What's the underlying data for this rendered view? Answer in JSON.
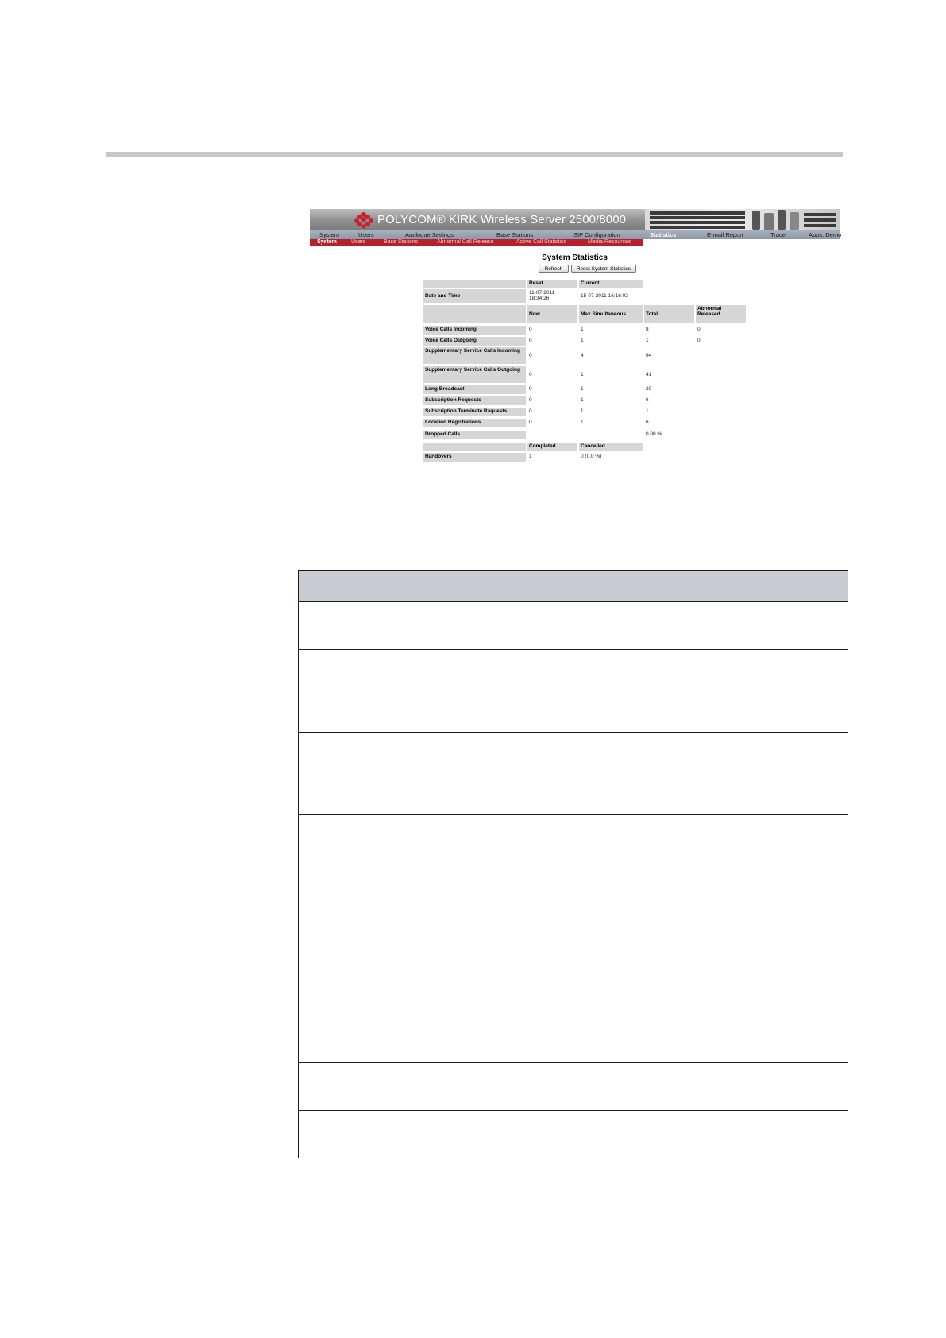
{
  "app": {
    "brand_title": "POLYCOM® KIRK Wireless Server 2500/8000"
  },
  "nav_main": [
    {
      "label": "System",
      "active": false
    },
    {
      "label": "Users",
      "active": false
    },
    {
      "label": "Analogue Settings",
      "active": false
    },
    {
      "label": "Base Stations",
      "active": false
    },
    {
      "label": "SIP Configuration",
      "active": false
    },
    {
      "label": "Statistics",
      "active": true
    },
    {
      "label": "E-mail Report",
      "active": false
    },
    {
      "label": "Trace",
      "active": false
    },
    {
      "label": "Apps. Demo",
      "active": false
    }
  ],
  "nav_sub": [
    {
      "label": "System",
      "active": true
    },
    {
      "label": "Users",
      "active": false
    },
    {
      "label": "Base Stations",
      "active": false
    },
    {
      "label": "Abnormal Call Release",
      "active": false
    },
    {
      "label": "Active Call Statistics",
      "active": false
    },
    {
      "label": "Media Resources",
      "active": false
    }
  ],
  "stats": {
    "title": "System Statistics",
    "refresh_label": "Refresh",
    "reset_label": "Reset System Statistics",
    "time_headers": [
      "Reset",
      "Current"
    ],
    "date_label": "Date and Time",
    "reset_time": "11-07-2011\n18:34:26",
    "current_time": "15-07-2011 16:16:02",
    "call_headers": [
      "Now",
      "Max Simultaneous",
      "Total",
      "Abnormal Released"
    ],
    "rows": [
      {
        "label": "Voice Calls Incoming",
        "now": "0",
        "max": "1",
        "total": "8",
        "abnormal": "0"
      },
      {
        "label": "Voice Calls Outgoing",
        "now": "0",
        "max": "1",
        "total": "1",
        "abnormal": "0"
      },
      {
        "label": "Supplementary Service Calls Incoming",
        "now": "0",
        "max": "4",
        "total": "64",
        "abnormal": ""
      },
      {
        "label": "Supplementary Service Calls Outgoing",
        "now": "0",
        "max": "1",
        "total": "41",
        "abnormal": ""
      },
      {
        "label": "Long Broadcast",
        "now": "0",
        "max": "1",
        "total": "20",
        "abnormal": ""
      },
      {
        "label": "Subscription Requests",
        "now": "0",
        "max": "1",
        "total": "6",
        "abnormal": ""
      },
      {
        "label": "Subscription Terminate Requests",
        "now": "0",
        "max": "1",
        "total": "1",
        "abnormal": ""
      },
      {
        "label": "Location Registrations",
        "now": "0",
        "max": "1",
        "total": "6",
        "abnormal": ""
      }
    ],
    "dropped_label": "Dropped Calls",
    "dropped_value": "0.00 %",
    "handover_headers": [
      "Completed",
      "Cancelled"
    ],
    "handover_label": "Handovers",
    "handover_completed": "1",
    "handover_cancelled": "0 (0.0 %)"
  },
  "doc_table": {
    "header": [
      "",
      ""
    ],
    "row_heights": [
      60,
      104,
      104,
      126,
      126,
      60,
      60,
      60
    ]
  }
}
